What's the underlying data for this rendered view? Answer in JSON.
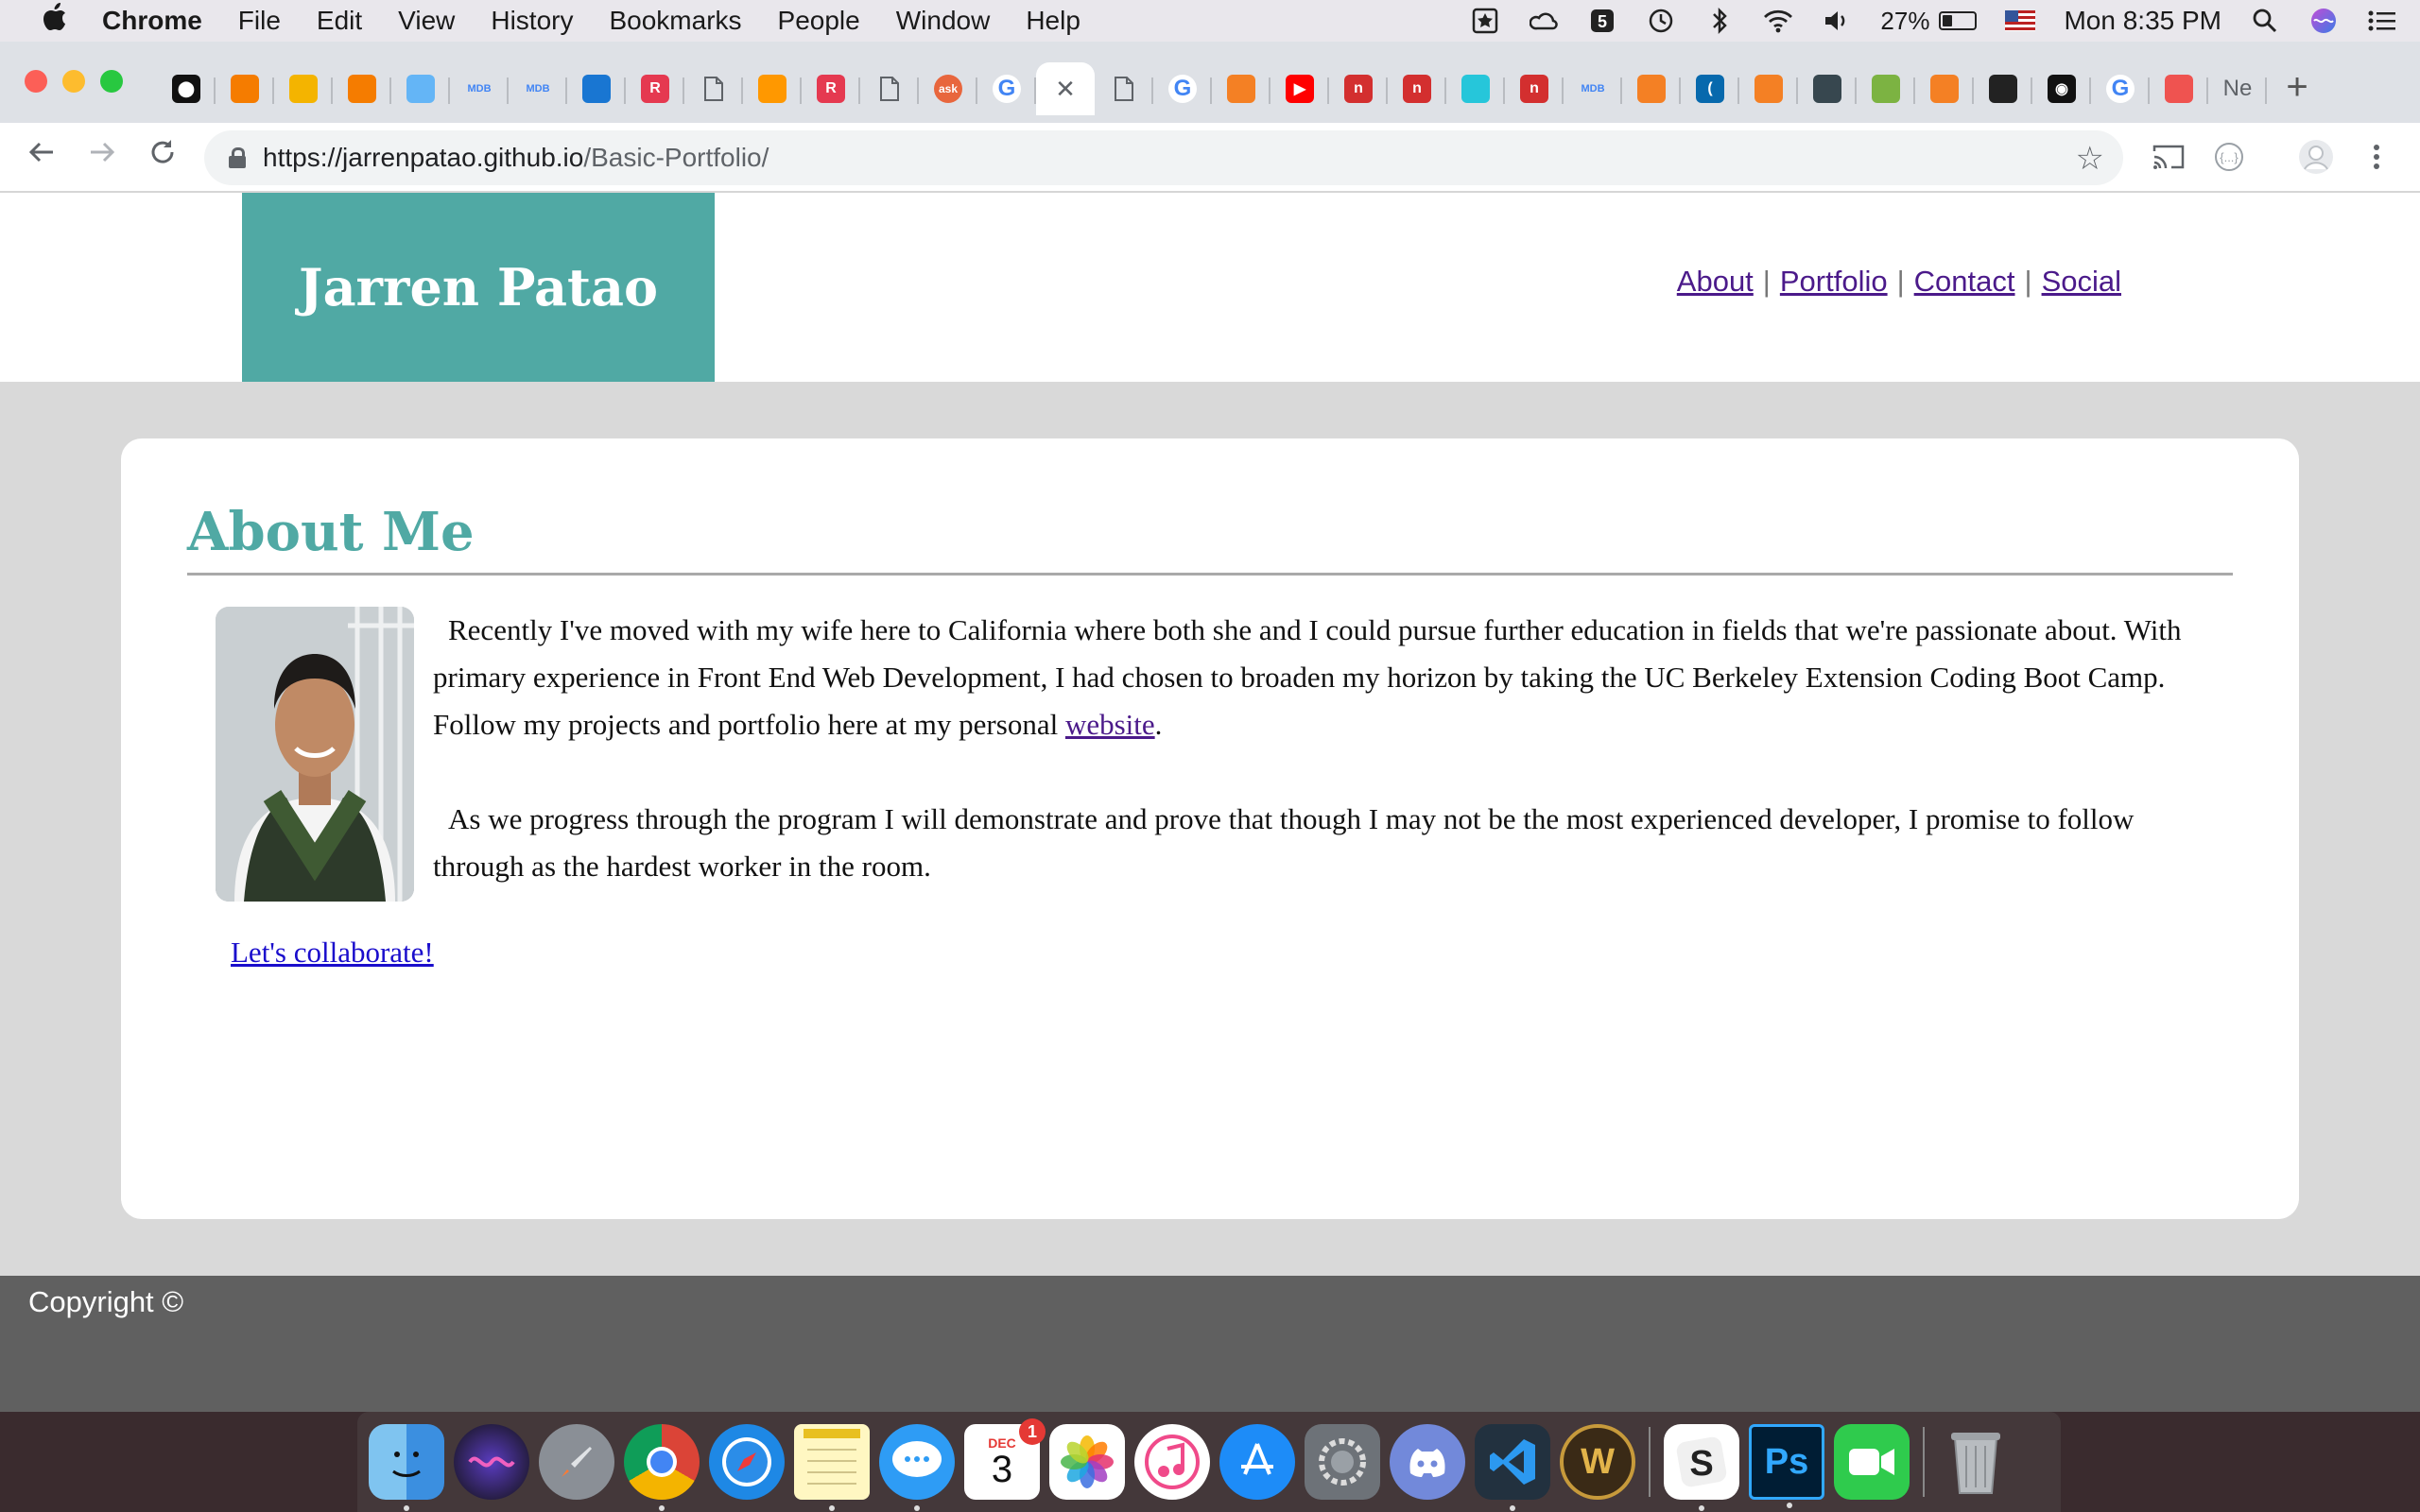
{
  "menubar": {
    "items": [
      "Chrome",
      "File",
      "Edit",
      "View",
      "History",
      "Bookmarks",
      "People",
      "Window",
      "Help"
    ],
    "battery_percent": "27%",
    "battery_level": 0.27,
    "clock": "Mon 8:35 PM"
  },
  "tabs": [
    {
      "icon": "github-icon",
      "color": "#111111",
      "glyph": "⬤"
    },
    {
      "icon": "box-icon",
      "color": "#f57c00",
      "glyph": ""
    },
    {
      "icon": "slides-icon",
      "color": "#f4b400",
      "glyph": ""
    },
    {
      "icon": "box-icon",
      "color": "#f57c00",
      "glyph": ""
    },
    {
      "icon": "cloud-icon",
      "color": "#64b5f6",
      "glyph": ""
    },
    {
      "icon": "mdb-icon",
      "color": "#4285f4",
      "glyph": "MDB"
    },
    {
      "icon": "mdb-icon",
      "color": "#4285f4",
      "glyph": "MDB"
    },
    {
      "icon": "flag-icon",
      "color": "#1976d2",
      "glyph": ""
    },
    {
      "icon": "r-icon",
      "color": "#e53950",
      "glyph": "R"
    },
    {
      "icon": "page-icon",
      "color": "#ffffff",
      "glyph": ""
    },
    {
      "icon": "tensorflow-icon",
      "color": "#ff9800",
      "glyph": ""
    },
    {
      "icon": "r-icon",
      "color": "#e53950",
      "glyph": "R"
    },
    {
      "icon": "page-icon",
      "color": "#ffffff",
      "glyph": ""
    },
    {
      "icon": "ask-icon",
      "color": "#e8663d",
      "glyph": "ask"
    },
    {
      "icon": "google-icon",
      "color": "#4285f4",
      "glyph": "G"
    },
    {
      "icon": "close-icon",
      "color": "#ffffff",
      "glyph": "✕",
      "active": true
    },
    {
      "icon": "page-icon",
      "color": "#ffffff",
      "glyph": ""
    },
    {
      "icon": "google-icon",
      "color": "#4285f4",
      "glyph": "G"
    },
    {
      "icon": "stackoverflow-icon",
      "color": "#f48024",
      "glyph": ""
    },
    {
      "icon": "youtube-icon",
      "color": "#ff0000",
      "glyph": "▶"
    },
    {
      "icon": "n-icon",
      "color": "#d32f2f",
      "glyph": "n"
    },
    {
      "icon": "n-icon",
      "color": "#d32f2f",
      "glyph": "n"
    },
    {
      "icon": "chart-icon",
      "color": "#26c6da",
      "glyph": ""
    },
    {
      "icon": "n-icon",
      "color": "#d32f2f",
      "glyph": "n"
    },
    {
      "icon": "mdb-icon",
      "color": "#4285f4",
      "glyph": "MDB"
    },
    {
      "icon": "stackoverflow-icon",
      "color": "#f48024",
      "glyph": ""
    },
    {
      "icon": "jquery-icon",
      "color": "#0769ad",
      "glyph": "("
    },
    {
      "icon": "stackoverflow-icon",
      "color": "#f48024",
      "glyph": ""
    },
    {
      "icon": "grid-icon",
      "color": "#37474f",
      "glyph": ""
    },
    {
      "icon": "green-icon",
      "color": "#7cb342",
      "glyph": ""
    },
    {
      "icon": "stackoverflow-icon",
      "color": "#f48024",
      "glyph": ""
    },
    {
      "icon": "dark-icon",
      "color": "#222222",
      "glyph": ""
    },
    {
      "icon": "circle-icon",
      "color": "#111111",
      "glyph": "◉"
    },
    {
      "icon": "google-icon",
      "color": "#4285f4",
      "glyph": "G"
    },
    {
      "icon": "swirl-icon",
      "color": "#ef5350",
      "glyph": ""
    },
    {
      "icon": "text-tab",
      "color": "#ffffff",
      "glyph": "Ne"
    }
  ],
  "address": {
    "host": "https://jarrenpatao.github.io",
    "path": "/Basic-Portfolio/"
  },
  "site": {
    "brand": "Jarren Patao",
    "nav": [
      "About",
      "Portfolio",
      "Contact",
      "Social"
    ],
    "nav_separator": "|",
    "about": {
      "heading": "About Me",
      "paragraph1_before": "Recently I've moved with my wife here to California where both she and I could pursue further education in fields that we're passionate about. With primary experience in Front End Web Development, I had chosen to broaden my horizon by taking the UC Berkeley Extension Coding Boot Camp. Follow my projects and portfolio here at my personal ",
      "paragraph1_link": "website",
      "paragraph1_after": ".",
      "paragraph2": "As we progress through the program I will demonstrate and prove that though I may not be the most experienced developer, I promise to follow through as the hardest worker in the room.",
      "collab_link": "Let's collaborate!"
    },
    "footer": "Copyright ©"
  },
  "dock": {
    "calendar_month": "DEC",
    "calendar_day": "3",
    "calendar_badge": "1"
  },
  "colors": {
    "brand_teal": "#50a9a4",
    "footer_gray": "#606060",
    "page_bg": "#d9d9d9"
  }
}
